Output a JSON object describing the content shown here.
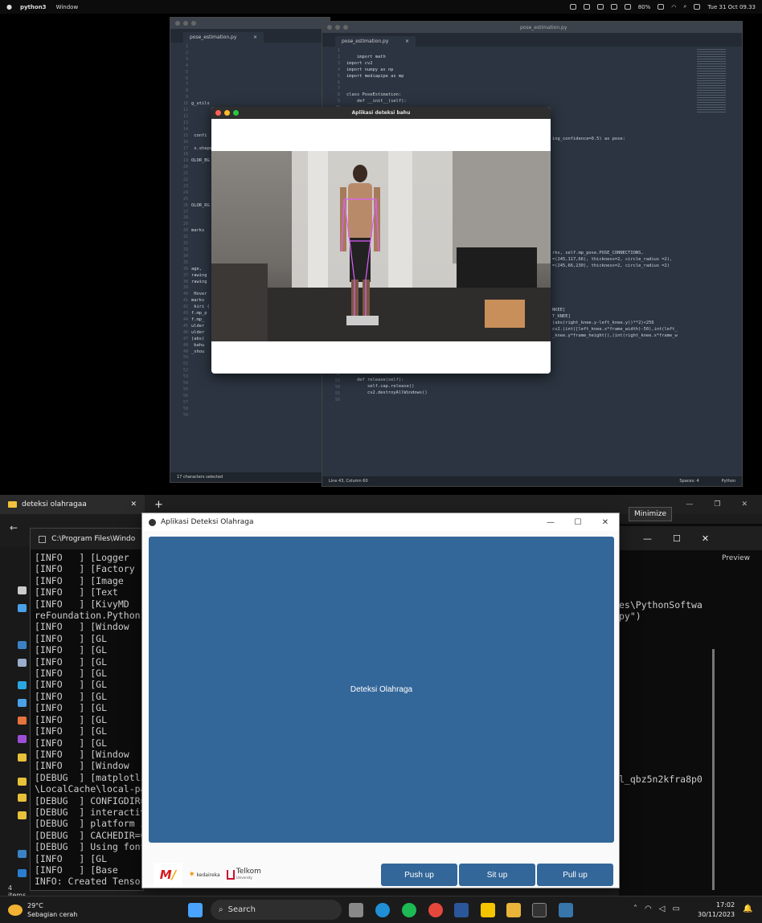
{
  "mac": {
    "app_name": "python3",
    "menu": [
      "Window"
    ],
    "battery": "80%",
    "datetime": "Tue 31 Oct 09.33"
  },
  "editor_back": {
    "tab": "pose_estimation.py",
    "status": "17 characters selected",
    "line_numbers": [
      "1",
      "2",
      "3",
      "4",
      "5",
      "6",
      "7",
      "8",
      "9",
      "10",
      "11",
      "12",
      "13",
      "14",
      "15",
      "16",
      "17",
      "18",
      "19",
      "20",
      "21",
      "22",
      "23",
      "24",
      "25",
      "26",
      "27",
      "28",
      "29",
      "30",
      "31",
      "32",
      "33",
      "34",
      "35",
      "36",
      "37",
      "38",
      "39",
      "40",
      "41",
      "42",
      "43",
      "44",
      "45",
      "46",
      "47",
      "48",
      "49",
      "50",
      "51",
      "52",
      "53",
      "54",
      "55",
      "56",
      "57",
      "58",
      "59"
    ],
    "code": "\n\n\n\n\n\n\n\n\ng_utils\n\n\n\n\n confi\n\n s.shape\n\nOLOR_BG\n\n\n\n\n\n\nOLOR_RG\n\n\n\nmarks\n\n\n\n\n\nage, \nrawing\nrawing\n\n Hover\nmarks\n kiri (\nf.mp_p\nf.mp_\nulder\nulder\n(abs(\n bahu\n_shou"
  },
  "editor_front": {
    "title": "pose_estimation.py",
    "tab": "pose_estimation.py",
    "status_left": "Line 43, Column 60",
    "status_spaces": "Spaces: 4",
    "status_lang": "Python",
    "line_numbers": [
      "1",
      "2",
      "3",
      "4",
      "5",
      "6",
      "7",
      "8",
      "9",
      "10",
      "11",
      "12",
      "13",
      "14",
      "15",
      "16",
      "17",
      "18",
      "19",
      "20",
      "21",
      "22",
      "23",
      "24",
      "25",
      "26",
      "27",
      "28",
      "29",
      "30",
      "31",
      "32",
      "33",
      "34",
      "35",
      "36",
      "37",
      "38",
      "39",
      "40",
      "41",
      "42",
      "43",
      "44",
      "45",
      "46",
      "47",
      "48",
      "49",
      "50",
      "51",
      "52",
      "53",
      "54",
      "55",
      "56"
    ],
    "code_top": "import math\nimport cv2\nimport numpy as np\nimport mediapipe as mp\n\n\nclass PoseEstimation:\n    def __init__(self):",
    "code_right": "ing_confidence=0.5) as pose:\n\n\n\n\n\n\n\n\n\n\n\n\n\n\n\n\n\nrks, self.mp_pose.POSE_CONNECTIONS,\n=(245,117,66), thickness=2, circle_radius =2),\n=(245,66,230), thickness=2, circle_radius =2)\n\n\n\n\n\n\nNKEE]\nT_KNEE]\n(abs(right_knee.y-left_knee.y))**2)<256\ncv2.(int([left_knee.x*frame_width)-50),int(left_\n_knee.y*frame_height)),(int(right_knee.x*frame_w",
    "code_bottom": "    def release(self):\n        self.cap.release()\n        cv2.destroyAllWindows()"
  },
  "pose_window": {
    "title": "Aplikasi deteksi bahu"
  },
  "explorer": {
    "tab_title": "deteksi olahragaa",
    "new_tab": "+",
    "status_items": "4 items",
    "preview": "Preview"
  },
  "cmd": {
    "title": "C:\\Program Files\\Windows",
    "lines": [
      "[INFO   ] [Logger",
      "[INFO   ] [Factory",
      "[INFO   ] [Image",
      "[INFO   ] [Text",
      "[INFO   ] [KivyMD",
      "reFoundation.Python",
      "[INFO   ] [Window",
      "[INFO   ] [GL",
      "[INFO   ] [GL",
      "[INFO   ] [GL",
      "[INFO   ] [GL",
      "[INFO   ] [GL",
      "[INFO   ] [GL",
      "[INFO   ] [GL",
      "[INFO   ] [GL",
      "[INFO   ] [GL",
      "[INFO   ] [GL",
      "[INFO   ] [Window",
      "[INFO   ] [Window",
      "[DEBUG  ] [matplotli",
      "\\LocalCache\\local-pa",
      "[DEBUG  ] CONFIGDIR=",
      "[DEBUG  ] interactiv",
      "[DEBUG  ] platform i",
      "[DEBUG  ] CACHEDIR=C",
      "[DEBUG  ] Using font",
      "[INFO   ] [GL",
      "[INFO   ] [Base",
      "INFO: Created Tensor"
    ]
  },
  "bg_right": {
    "tooltip": "Minimize",
    "text1": "es\\PythonSoftwa",
    "text2": "py\")",
    "text3": "l_qbz5n2kfra8p0"
  },
  "kivy": {
    "title": "Aplikasi Deteksi Olahraga",
    "main_button": "Deteksi Olahraga",
    "buttons": [
      "Push up",
      "Sit up",
      "Pull up"
    ],
    "logo_kedai": "kedaireka",
    "logo_telkom": "Telkom",
    "logo_telkom_sub": "University"
  },
  "taskbar": {
    "weather_temp": "29°C",
    "weather_desc": "Sebagian cerah",
    "search_placeholder": "Search",
    "time": "17:02",
    "date": "30/11/2023"
  },
  "colors": {
    "kivy_blue": "#336699",
    "editor_bg": "#2b3440"
  }
}
